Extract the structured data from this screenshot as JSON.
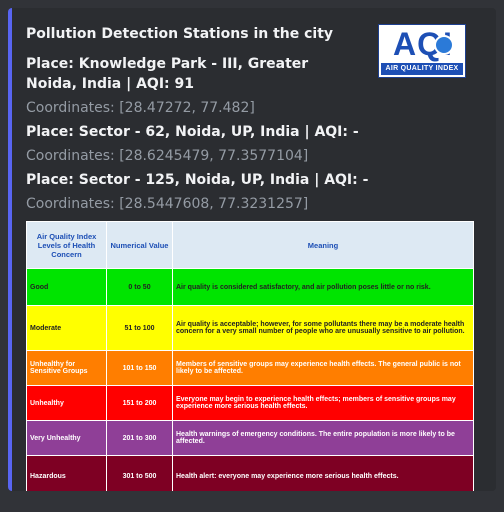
{
  "embed": {
    "title": "Pollution Detection Stations in the city",
    "accent_color": "#5865f2",
    "thumbnail": {
      "logo_text": "AQI",
      "band_text": "AIR QUALITY INDEX",
      "icon": "aqi-logo"
    }
  },
  "stations": [
    {
      "place": "Place: Knowledge Park - III, Greater Noida, India | AQI: 91",
      "coordinates": "Coordinates: [28.47272, 77.482]"
    },
    {
      "place": "Place: Sector - 62, Noida, UP, India | AQI: -",
      "coordinates": "Coordinates: [28.6245479, 77.3577104]"
    },
    {
      "place": "Place: Sector - 125, Noida, UP, India | AQI: -",
      "coordinates": "Coordinates: [28.5447608, 77.3231257]"
    }
  ],
  "aqi_table": {
    "headers": [
      "Air Quality Index Levels of Health Concern",
      "Numerical Value",
      "Meaning"
    ],
    "rows": [
      {
        "level": "Good",
        "value": "0 to 50",
        "meaning": "Air quality is considered satisfactory, and air pollution poses little or no risk.",
        "bg": "#00e400",
        "fg": "#222222"
      },
      {
        "level": "Moderate",
        "value": "51 to 100",
        "meaning": "Air quality is acceptable; however, for some pollutants there may be a moderate health concern for a very small number of people who are unusually sensitive to air pollution.",
        "bg": "#ffff00",
        "fg": "#222222"
      },
      {
        "level": "Unhealthy for Sensitive Groups",
        "value": "101 to 150",
        "meaning": "Members of sensitive groups may experience health effects. The general public is not likely to be affected.",
        "bg": "#ff7e00",
        "fg": "#ffffff"
      },
      {
        "level": "Unhealthy",
        "value": "151 to 200",
        "meaning": "Everyone may begin to experience health effects; members of sensitive groups may experience more serious health effects.",
        "bg": "#ff0000",
        "fg": "#ffffff"
      },
      {
        "level": "Very Unhealthy",
        "value": "201 to 300",
        "meaning": "Health warnings of emergency conditions. The entire population is more likely to be affected.",
        "bg": "#8f3f97",
        "fg": "#ffffff"
      },
      {
        "level": "Hazardous",
        "value": "301 to 500",
        "meaning": "Health alert: everyone may experience more serious health effects.",
        "bg": "#7e0023",
        "fg": "#ffffff"
      }
    ]
  }
}
